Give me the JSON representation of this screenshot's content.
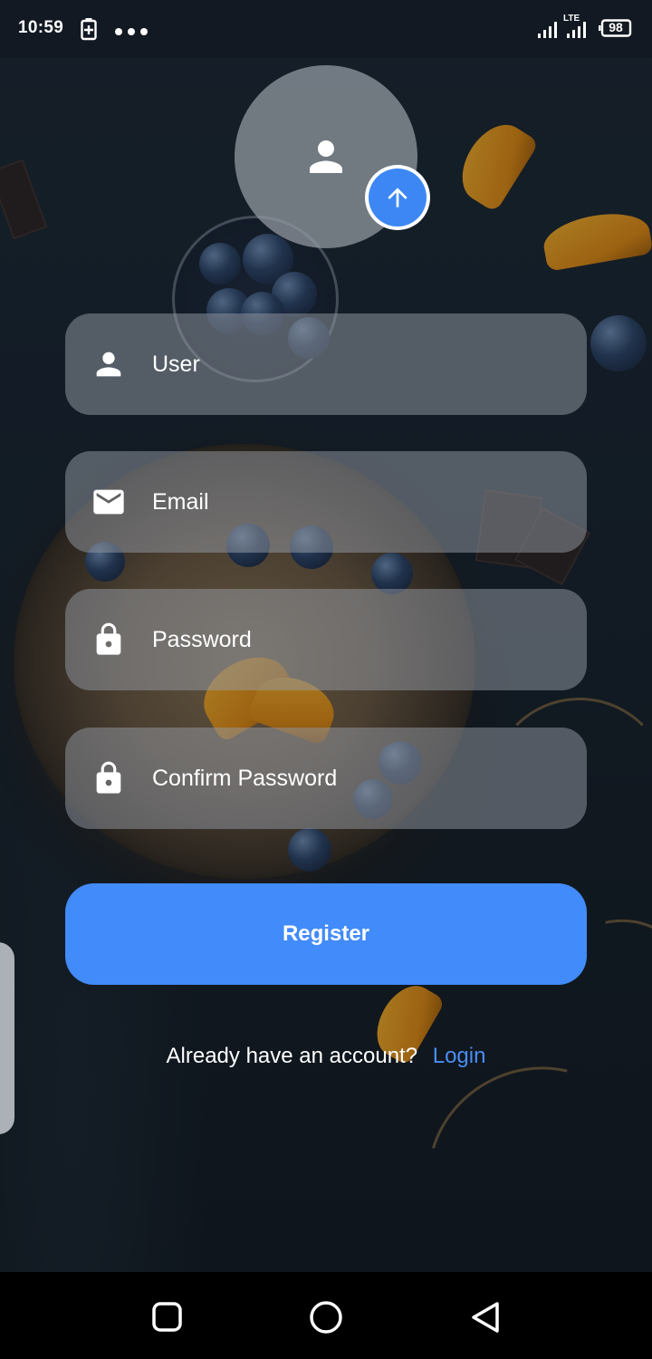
{
  "status_bar": {
    "time": "10:59",
    "network": "LTE",
    "battery": "98",
    "icons": [
      "battery-saver-icon",
      "more-dots-icon",
      "signal-icon",
      "lte-signal-icon",
      "battery-icon"
    ]
  },
  "avatar": {
    "icon": "person-icon",
    "upload_icon": "arrow-up-icon"
  },
  "form": {
    "user": {
      "placeholder": "User",
      "value": "",
      "icon": "person-icon"
    },
    "email": {
      "placeholder": "Email",
      "value": "",
      "icon": "mail-icon"
    },
    "password": {
      "placeholder": "Password",
      "value": "",
      "icon": "lock-icon"
    },
    "confirm_password": {
      "placeholder": "Confirm Password",
      "value": "",
      "icon": "lock-icon"
    },
    "register_label": "Register"
  },
  "login_prompt": {
    "text": "Already have an account?",
    "link": "Login"
  },
  "nav_bar": {
    "icons": [
      "recent-apps-icon",
      "home-icon",
      "back-icon"
    ]
  },
  "colors": {
    "accent": "#428bfa",
    "link": "#4a8ef5",
    "field_bg": "#969ca5",
    "text": "#ffffff"
  }
}
